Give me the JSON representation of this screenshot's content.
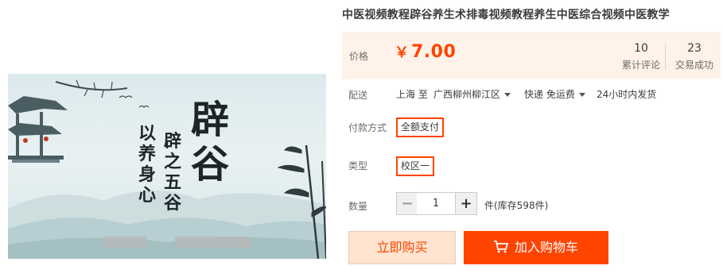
{
  "product": {
    "title": "中医视频教程辟谷养生术排毒视频教程养生中医综合视频中医教学",
    "image": {
      "big_text": "辟谷",
      "verse_col1": "以养身心",
      "verse_col2": "辟之五谷"
    }
  },
  "price": {
    "label": "价格",
    "currency": "￥",
    "value": "7.00",
    "reviews_count": "10",
    "reviews_label": "累计评论",
    "sales_count": "23",
    "sales_label": "交易成功"
  },
  "shipping": {
    "label": "配送",
    "from": "上海 至",
    "to": "广西柳州柳江区",
    "method": "快递 免运费",
    "dispatch": "24小时内发货"
  },
  "payment": {
    "label": "付款方式",
    "selected": "全额支付"
  },
  "type": {
    "label": "类型",
    "selected": "校区一"
  },
  "quantity": {
    "label": "数量",
    "value": "1",
    "minus": "−",
    "plus": "+",
    "stock_text": "件(库存598件)"
  },
  "actions": {
    "buy_now": "立即购买",
    "add_to_cart": "加入购物车"
  },
  "colors": {
    "accent": "#ff4400",
    "price_bg": "#fff2e8",
    "buy_bg": "#ffe4d0"
  }
}
